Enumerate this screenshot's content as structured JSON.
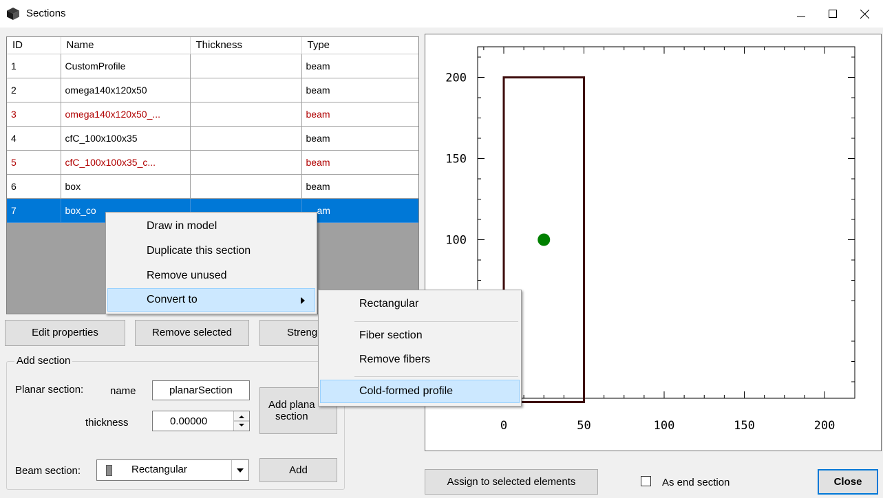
{
  "window": {
    "title": "Sections"
  },
  "table": {
    "columns": [
      "ID",
      "Name",
      "Thickness",
      "Type"
    ],
    "rows": [
      {
        "id": "1",
        "name": "CustomProfile",
        "thickness": "",
        "type": "beam"
      },
      {
        "id": "2",
        "name": "omega140x120x50",
        "thickness": "",
        "type": "beam"
      },
      {
        "id": "3",
        "name": "omega140x120x50_...",
        "thickness": "",
        "type": "beam"
      },
      {
        "id": "4",
        "name": "cfC_100x100x35",
        "thickness": "",
        "type": "beam"
      },
      {
        "id": "5",
        "name": "cfC_100x100x35_c...",
        "thickness": "",
        "type": "beam"
      },
      {
        "id": "6",
        "name": "box",
        "thickness": "",
        "type": "beam"
      },
      {
        "id": "7",
        "name": "box_co",
        "thickness": "",
        "type": "am"
      }
    ]
  },
  "buttons": {
    "edit_properties": "Edit properties",
    "remove_selected": "Remove selected",
    "strength": "Streng",
    "add_planar": "Add plana\nsection",
    "add": "Add",
    "assign": "Assign to selected elements",
    "close": "Close"
  },
  "add_section": {
    "legend": "Add section",
    "planar_label": "Planar section:",
    "name_label": "name",
    "name_value": "planarSection",
    "thickness_label": "thickness",
    "thickness_value": "0.00000",
    "beam_label": "Beam section:",
    "beam_value": "Rectangular"
  },
  "end_section": {
    "label": "As end section",
    "checked": false
  },
  "context_menu": {
    "items": [
      "Draw in model",
      "Duplicate this section",
      "Remove unused",
      "Convert to"
    ],
    "submenu": [
      "Rectangular",
      "Fiber section",
      "Remove fibers",
      "Cold-formed profile"
    ]
  },
  "plot": {
    "x_ticks": [
      "0",
      "50",
      "100",
      "150",
      "200"
    ],
    "y_ticks": [
      "200",
      "150",
      "100"
    ],
    "rect_color": "#3d0c0c",
    "point_color": "#008000",
    "section_rect": {
      "x0": 0,
      "y0": 0,
      "x1": 50,
      "y1": 200
    },
    "centroid": {
      "x": 25,
      "y": 100
    }
  }
}
